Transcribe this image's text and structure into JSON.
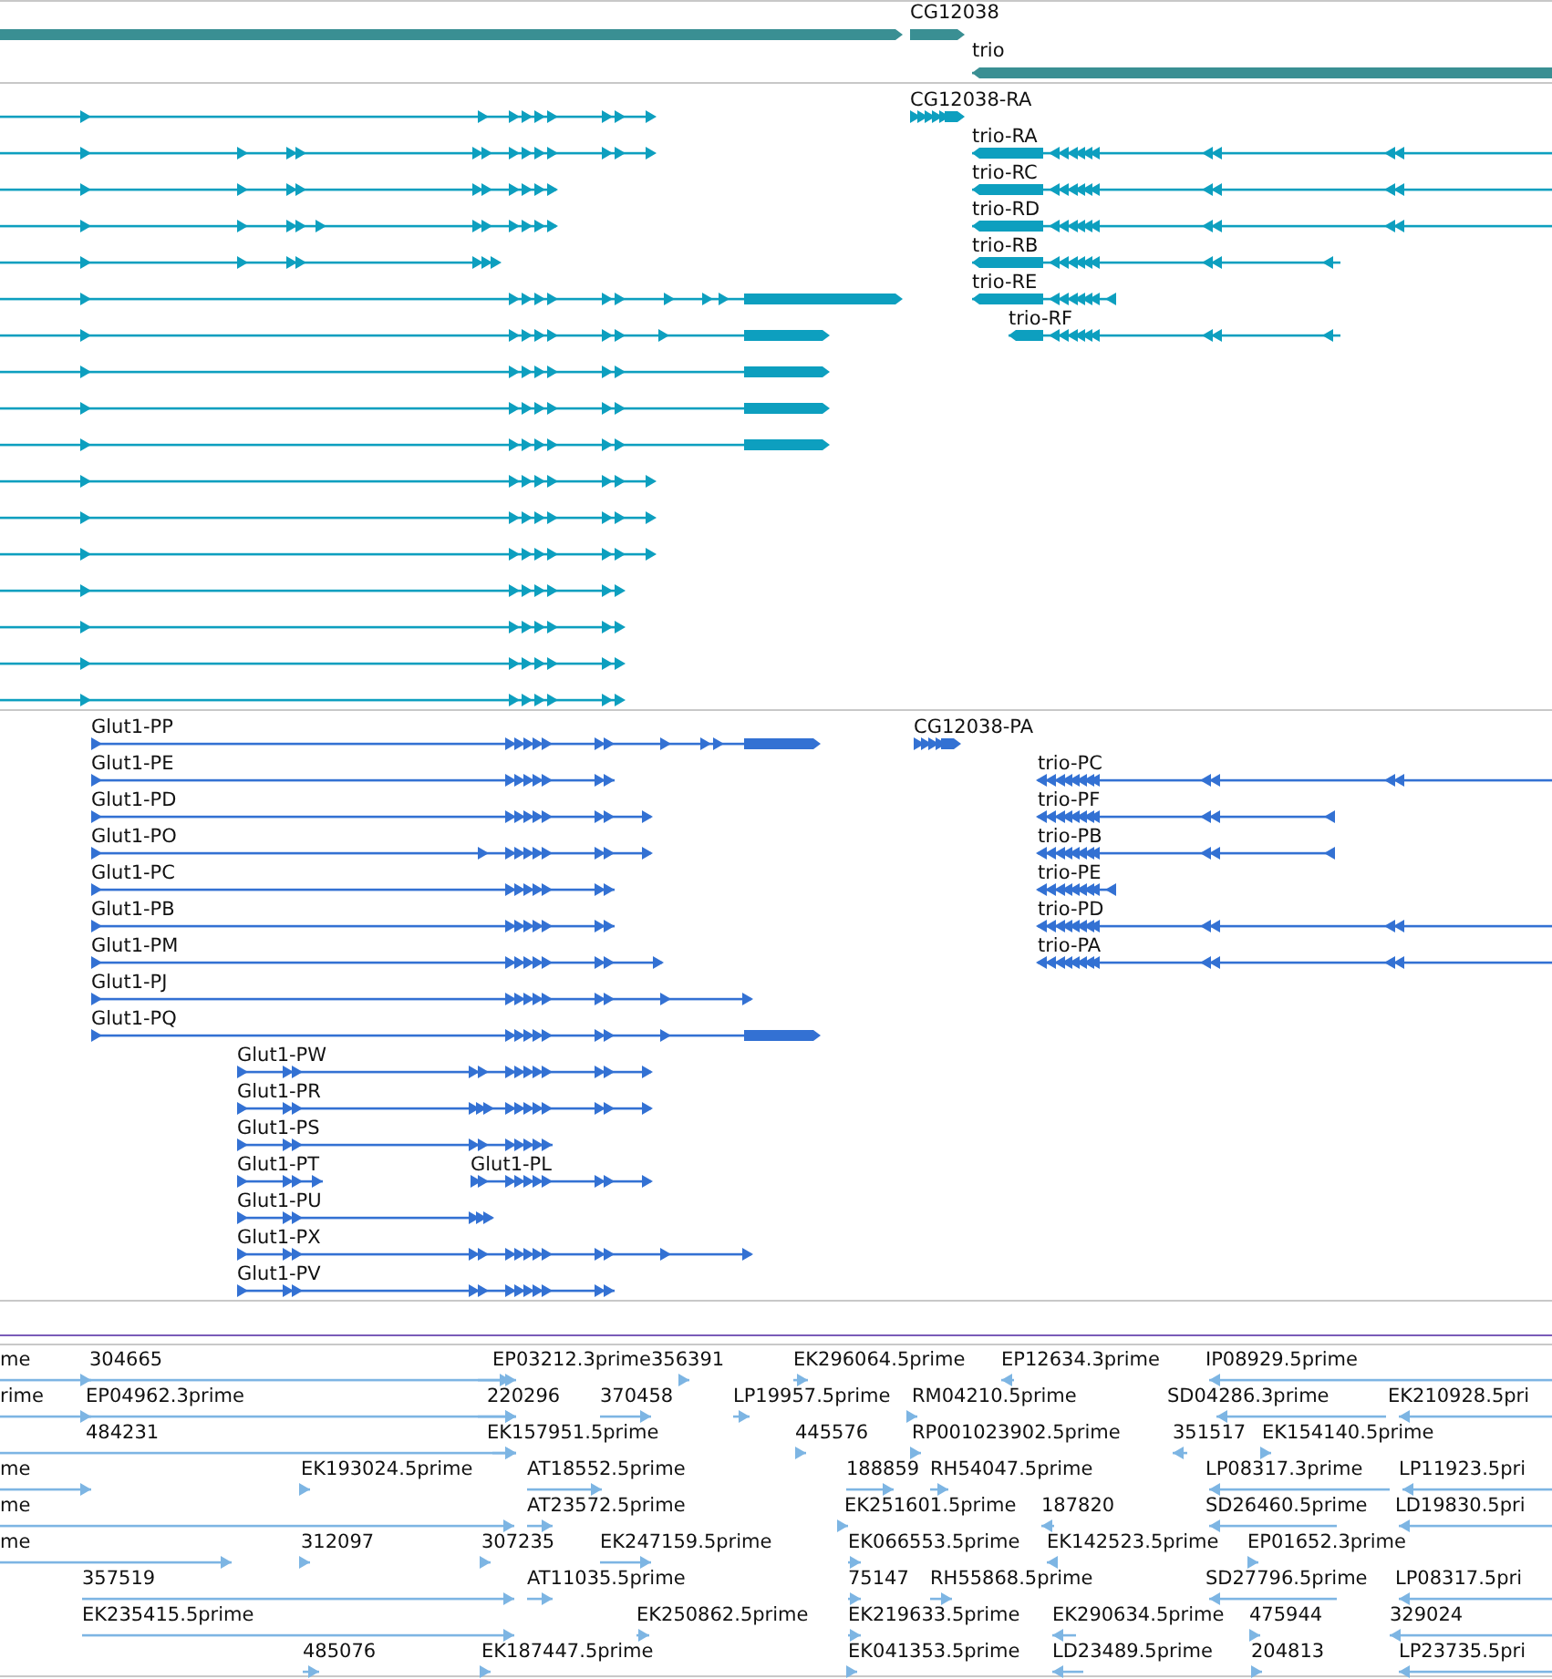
{
  "gene_track": {
    "features": [
      {
        "label": "CG12038"
      },
      {
        "label": "trio"
      }
    ]
  },
  "transcript_track": {
    "features": [
      {
        "label": "CG12038-RA"
      },
      {
        "label": "trio-RA"
      },
      {
        "label": "trio-RC"
      },
      {
        "label": "trio-RD"
      },
      {
        "label": "trio-RB"
      },
      {
        "label": "trio-RE"
      },
      {
        "label": "trio-RF"
      }
    ]
  },
  "protein_track": {
    "features": [
      {
        "label": "Glut1-PP"
      },
      {
        "label": "Glut1-PE"
      },
      {
        "label": "Glut1-PD"
      },
      {
        "label": "Glut1-PO"
      },
      {
        "label": "Glut1-PC"
      },
      {
        "label": "Glut1-PB"
      },
      {
        "label": "Glut1-PM"
      },
      {
        "label": "Glut1-PJ"
      },
      {
        "label": "Glut1-PQ"
      },
      {
        "label": "Glut1-PW"
      },
      {
        "label": "Glut1-PR"
      },
      {
        "label": "Glut1-PS"
      },
      {
        "label": "Glut1-PT"
      },
      {
        "label": "Glut1-PL"
      },
      {
        "label": "Glut1-PU"
      },
      {
        "label": "Glut1-PX"
      },
      {
        "label": "Glut1-PV"
      },
      {
        "label": "CG12038-PA"
      },
      {
        "label": "trio-PC"
      },
      {
        "label": "trio-PF"
      },
      {
        "label": "trio-PB"
      },
      {
        "label": "trio-PE"
      },
      {
        "label": "trio-PD"
      },
      {
        "label": "trio-PA"
      }
    ]
  },
  "est_track": {
    "rows": [
      {
        "features": [
          {
            "label": "me"
          },
          {
            "label": "304665"
          },
          {
            "label": "EP03212.3prime"
          },
          {
            "label": "356391"
          },
          {
            "label": "EK296064.5prime"
          },
          {
            "label": "EP12634.3prime"
          },
          {
            "label": "IP08929.5prime"
          }
        ]
      },
      {
        "features": [
          {
            "label": "rime"
          },
          {
            "label": "EP04962.3prime"
          },
          {
            "label": "220296"
          },
          {
            "label": "370458"
          },
          {
            "label": "LP19957.5prime"
          },
          {
            "label": "RM04210.5prime"
          },
          {
            "label": "SD04286.3prime"
          },
          {
            "label": "EK210928.5pri"
          }
        ]
      },
      {
        "features": [
          {
            "label": "484231"
          },
          {
            "label": "EK157951.5prime"
          },
          {
            "label": "445576"
          },
          {
            "label": "RP001023902.5prime"
          },
          {
            "label": "351517"
          },
          {
            "label": "EK154140.5prime"
          }
        ]
      },
      {
        "features": [
          {
            "label": "me"
          },
          {
            "label": "EK193024.5prime"
          },
          {
            "label": "AT18552.5prime"
          },
          {
            "label": "188859"
          },
          {
            "label": "RH54047.5prime"
          },
          {
            "label": "LP08317.3prime"
          },
          {
            "label": "LP11923.5pri"
          }
        ]
      },
      {
        "features": [
          {
            "label": "me"
          },
          {
            "label": "AT23572.5prime"
          },
          {
            "label": "EK251601.5prime"
          },
          {
            "label": "187820"
          },
          {
            "label": "SD26460.5prime"
          },
          {
            "label": "LD19830.5pri"
          }
        ]
      },
      {
        "features": [
          {
            "label": "me"
          },
          {
            "label": "312097"
          },
          {
            "label": "307235"
          },
          {
            "label": "EK247159.5prime"
          },
          {
            "label": "EK066553.5prime"
          },
          {
            "label": "EK142523.5prime"
          },
          {
            "label": "EP01652.3prime"
          }
        ]
      },
      {
        "features": [
          {
            "label": "357519"
          },
          {
            "label": "AT11035.5prime"
          },
          {
            "label": "75147"
          },
          {
            "label": "RH55868.5prime"
          },
          {
            "label": "SD27796.5prime"
          },
          {
            "label": "LP08317.5pri"
          }
        ]
      },
      {
        "features": [
          {
            "label": "EK235415.5prime"
          },
          {
            "label": "EK250862.5prime"
          },
          {
            "label": "EK219633.5prime"
          },
          {
            "label": "EK290634.5prime"
          },
          {
            "label": "475944"
          },
          {
            "label": "329024"
          }
        ]
      },
      {
        "features": [
          {
            "label": "485076"
          },
          {
            "label": "EK187447.5prime"
          },
          {
            "label": "EK041353.5prime"
          },
          {
            "label": "LD23489.5prime"
          },
          {
            "label": "204813"
          },
          {
            "label": "LP23735.5pri"
          }
        ]
      }
    ]
  }
}
